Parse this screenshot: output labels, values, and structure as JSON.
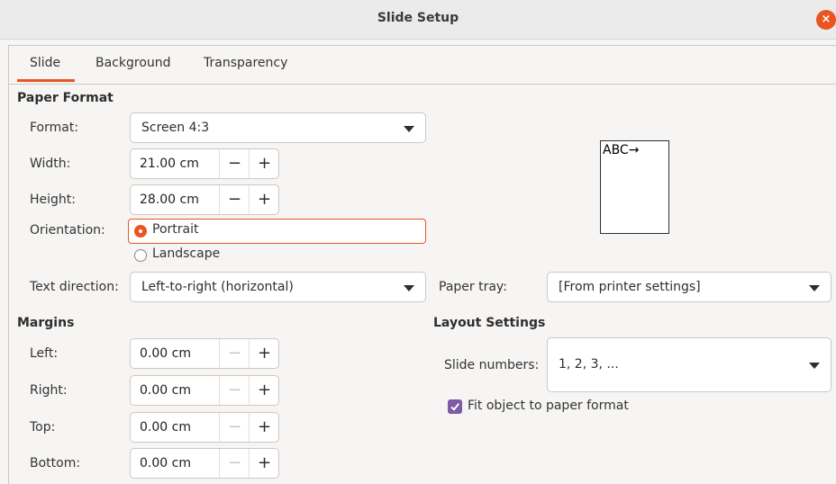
{
  "window": {
    "title": "Slide Setup",
    "close_glyph": "×"
  },
  "tabs": [
    {
      "label": "Slide",
      "active": true
    },
    {
      "label": "Background",
      "active": false
    },
    {
      "label": "Transparency",
      "active": false
    }
  ],
  "paper_format": {
    "heading": "Paper Format",
    "format": {
      "label": "Format:",
      "value": "Screen 4:3"
    },
    "width": {
      "label": "Width:",
      "value": "21.00 cm"
    },
    "height": {
      "label": "Height:",
      "value": "28.00 cm"
    },
    "orientation": {
      "label": "Orientation:",
      "options": [
        "Portrait",
        "Landscape"
      ],
      "selected": "Portrait"
    },
    "text_direction": {
      "label": "Text direction:",
      "value": "Left-to-right (horizontal)"
    },
    "paper_tray": {
      "label": "Paper tray:",
      "value": "[From printer settings]"
    },
    "preview_text": "ABC→"
  },
  "margins": {
    "heading": "Margins",
    "left": {
      "label": "Left:",
      "value": "0.00 cm"
    },
    "right": {
      "label": "Right:",
      "value": "0.00 cm"
    },
    "top": {
      "label": "Top:",
      "value": "0.00 cm"
    },
    "bottom": {
      "label": "Bottom:",
      "value": "0.00 cm"
    }
  },
  "layout_settings": {
    "heading": "Layout Settings",
    "slide_numbers": {
      "label": "Slide numbers:",
      "value": "1, 2, 3, ..."
    },
    "fit_object": {
      "label": "Fit object to paper format",
      "checked": true
    }
  },
  "spin_glyphs": {
    "minus": "−",
    "plus": "+"
  },
  "colors": {
    "accent": "#e95420",
    "checkbox": "#7d5ba6"
  }
}
